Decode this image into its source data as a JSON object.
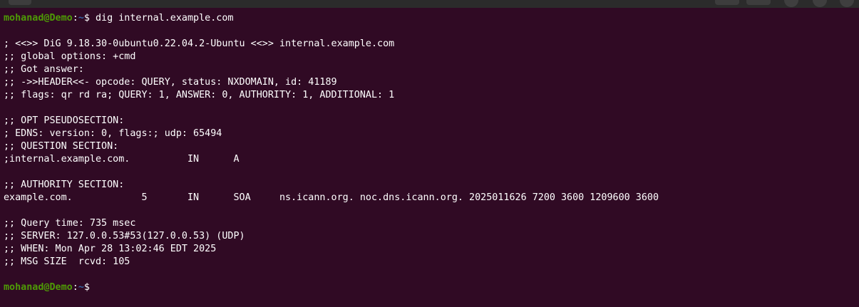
{
  "prompt": {
    "user": "mohanad@Demo",
    "sep": ":",
    "path": "~",
    "symbol": "$ "
  },
  "command": "dig internal.example.com",
  "output": [
    "",
    "; <<>> DiG 9.18.30-0ubuntu0.22.04.2-Ubuntu <<>> internal.example.com",
    ";; global options: +cmd",
    ";; Got answer:",
    ";; ->>HEADER<<- opcode: QUERY, status: NXDOMAIN, id: 41189",
    ";; flags: qr rd ra; QUERY: 1, ANSWER: 0, AUTHORITY: 1, ADDITIONAL: 1",
    "",
    ";; OPT PSEUDOSECTION:",
    "; EDNS: version: 0, flags:; udp: 65494",
    ";; QUESTION SECTION:",
    ";internal.example.com.\t\tIN\tA",
    "",
    ";; AUTHORITY SECTION:",
    "example.com.\t\t5\tIN\tSOA\tns.icann.org. noc.dns.icann.org. 2025011626 7200 3600 1209600 3600",
    "",
    ";; Query time: 735 msec",
    ";; SERVER: 127.0.0.53#53(127.0.0.53) (UDP)",
    ";; WHEN: Mon Apr 28 13:02:46 EDT 2025",
    ";; MSG SIZE  rcvd: 105",
    ""
  ]
}
